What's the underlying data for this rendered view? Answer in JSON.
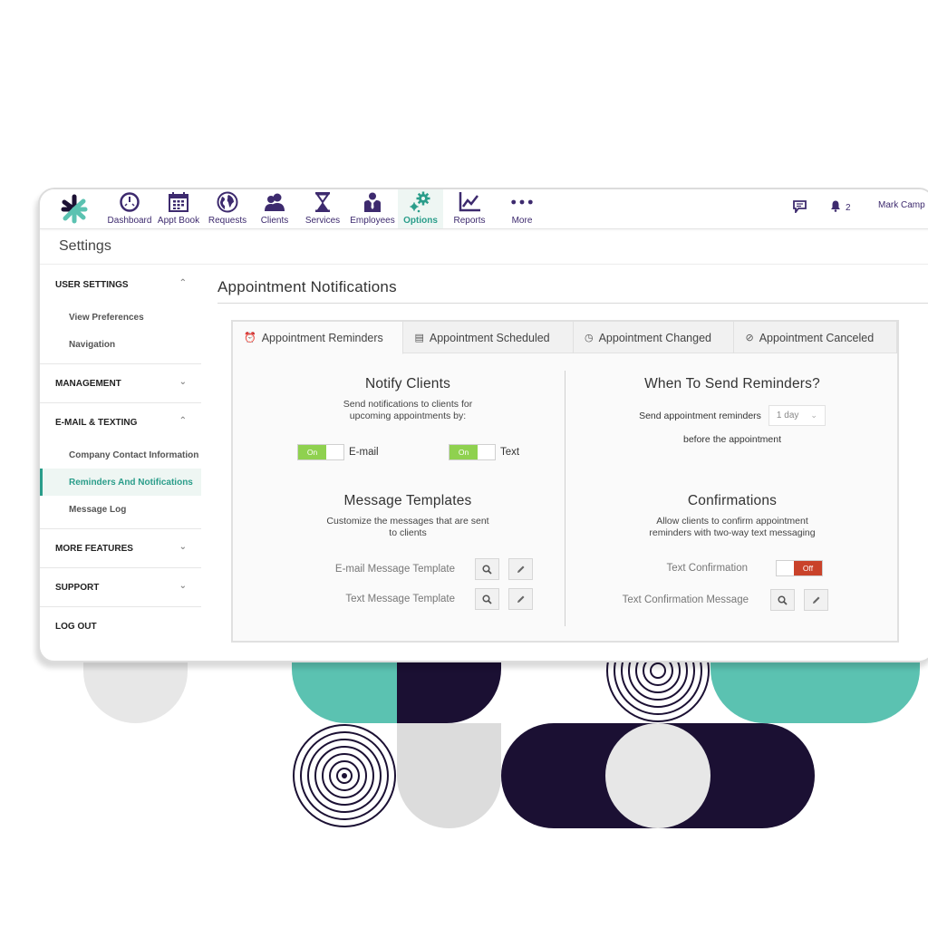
{
  "nav": {
    "items": [
      {
        "label": "Dashboard",
        "icon": "dashboard-gauge-icon"
      },
      {
        "label": "Appt Book",
        "icon": "calendar-icon"
      },
      {
        "label": "Requests",
        "icon": "globe-icon"
      },
      {
        "label": "Clients",
        "icon": "clients-users-icon"
      },
      {
        "label": "Services",
        "icon": "hourglass-icon"
      },
      {
        "label": "Employees",
        "icon": "employee-suit-icon"
      },
      {
        "label": "Options",
        "icon": "gears-icon",
        "active": true
      },
      {
        "label": "Reports",
        "icon": "line-chart-icon"
      },
      {
        "label": "More",
        "icon": "more-dots-icon"
      }
    ],
    "notifications_count": "2",
    "user_name": "Mark Camp"
  },
  "settings": {
    "title": "Settings"
  },
  "sidebar": {
    "sections": [
      {
        "label": "USER SETTINGS",
        "expanded": true,
        "items": [
          {
            "label": "View Preferences"
          },
          {
            "label": "Navigation"
          }
        ]
      },
      {
        "label": "MANAGEMENT",
        "expanded": false
      },
      {
        "label": "E-MAIL & TEXTING",
        "expanded": true,
        "items": [
          {
            "label": "Company Contact Information"
          },
          {
            "label": "Reminders And Notifications",
            "active": true
          },
          {
            "label": "Message Log"
          }
        ]
      },
      {
        "label": "MORE FEATURES",
        "expanded": false
      },
      {
        "label": "SUPPORT",
        "expanded": false
      },
      {
        "label": "LOG OUT"
      }
    ]
  },
  "main": {
    "title": "Appointment Notifications",
    "tabs": [
      {
        "label": "Appointment Reminders",
        "icon": "alarm-clock-icon",
        "active": true
      },
      {
        "label": "Appointment Scheduled",
        "icon": "calendar-list-icon"
      },
      {
        "label": "Appointment Changed",
        "icon": "clock-icon"
      },
      {
        "label": "Appointment Canceled",
        "icon": "cancel-circle-icon"
      }
    ],
    "notify_clients": {
      "title": "Notify Clients",
      "description_line1": "Send notifications to clients for",
      "description_line2": "upcoming appointments by:",
      "email_toggle": {
        "state": "On",
        "label": "E-mail"
      },
      "text_toggle": {
        "state": "On",
        "label": "Text"
      }
    },
    "when_to_send": {
      "title": "When To Send Reminders?",
      "prefix": "Send appointment reminders",
      "selected": "1 day",
      "suffix": "before the appointment"
    },
    "message_templates": {
      "title": "Message Templates",
      "description_line1": "Customize the messages that are sent",
      "description_line2": "to clients",
      "rows": [
        {
          "label": "E-mail Message Template"
        },
        {
          "label": "Text Message Template"
        }
      ]
    },
    "confirmations": {
      "title": "Confirmations",
      "description_line1": "Allow clients to confirm appointment",
      "description_line2": "reminders with two-way text messaging",
      "text_confirmation": {
        "label": "Text Confirmation",
        "state": "Off"
      },
      "confirmation_message": {
        "label": "Text Confirmation Message"
      }
    }
  },
  "colors": {
    "brand_navy": "#1b1033",
    "brand_teal": "#5bc2b1",
    "active_teal": "#2a9d8a",
    "toggle_on": "#8fd14f",
    "toggle_off": "#c9422a",
    "nav_icon": "#3d2a6e"
  }
}
